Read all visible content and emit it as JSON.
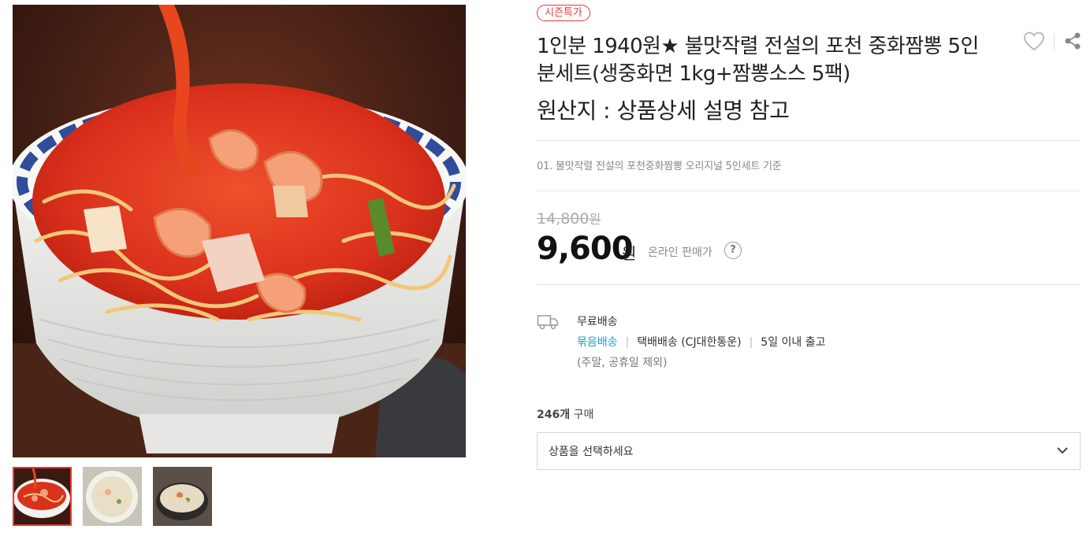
{
  "gallery": {
    "main_image": "jjamppong-bowl-photo",
    "thumbnails": [
      {
        "name": "thumb-spicy-jjamppong",
        "selected": true
      },
      {
        "name": "thumb-white-noodle-soup",
        "selected": false
      },
      {
        "name": "thumb-jjamppong-pot",
        "selected": false
      }
    ]
  },
  "product": {
    "badge": "시즌특가",
    "title": "1인분 1940원★ 불맛작렬 전설의 포천 중화짬뽕 5인분세트(생중화면 1kg+짬뽕소스 5팩)",
    "origin": "원산지 : 상품상세 설명 참고",
    "option_note": "01. 불맛작렬 전설의 포천중화짬뽕 오리지널 5인세트 기준",
    "icons": {
      "wishlist": "heart-icon",
      "share": "share-icon"
    }
  },
  "price": {
    "original": "14,800",
    "original_unit": "원",
    "sale": "9,600",
    "sale_unit": "원",
    "label": "온라인 판매가",
    "help": "?"
  },
  "shipping": {
    "fee": "무료배송",
    "bundle_link": "묶음배송",
    "method": "택배배송 (CJ대한통운)",
    "lead_time": "5일 이내 출고",
    "note": "(주말, 공휴일 제외)"
  },
  "purchase": {
    "count": "246개",
    "count_suffix": "구매",
    "select_placeholder": "상품을 선택하세요"
  },
  "colors": {
    "accent_red": "#e8373d",
    "link_blue": "#1e9dd5"
  }
}
